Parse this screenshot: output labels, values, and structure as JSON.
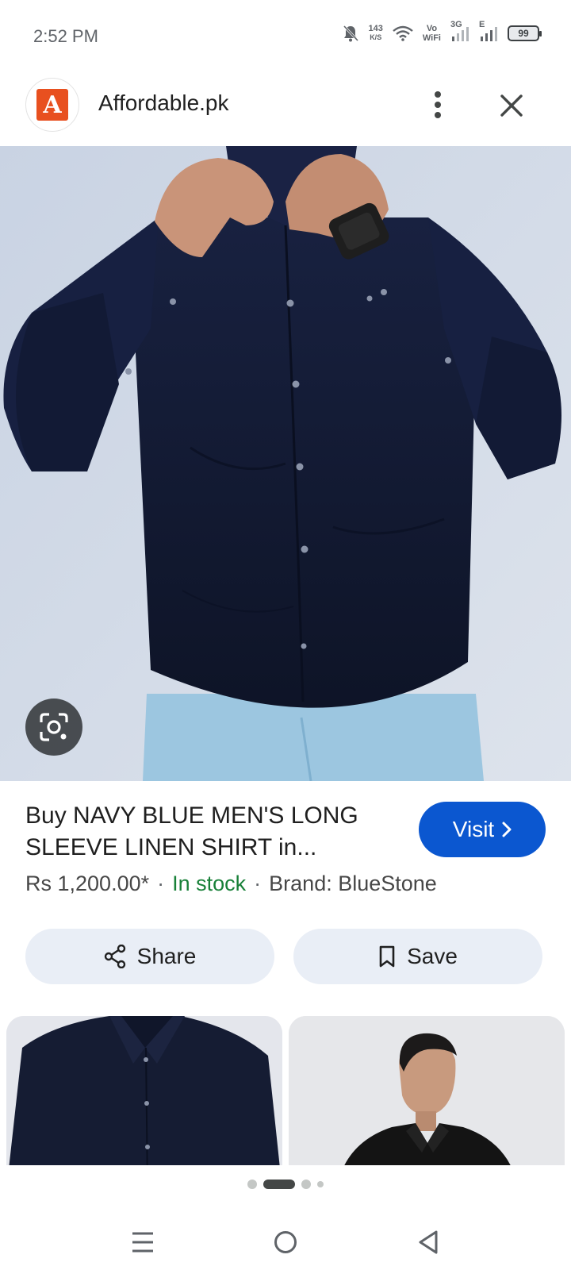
{
  "status_bar": {
    "time": "2:52 PM",
    "net_speed_value": "143",
    "net_speed_unit": "K/S",
    "vowifi_top": "Vo",
    "vowifi_bottom": "WiFi",
    "signal1_label": "3G",
    "signal2_label": "E",
    "battery": "99"
  },
  "header": {
    "logo_letter": "A",
    "site_name": "Affordable.pk"
  },
  "product": {
    "title": "Buy NAVY BLUE MEN'S LONG SLEEVE LINEN SHIRT in...",
    "price": "Rs 1,200.00*",
    "availability": "In stock",
    "brand": "Brand: BlueStone",
    "separator": "·"
  },
  "actions": {
    "visit_label": "Visit",
    "share_label": "Share",
    "save_label": "Save"
  },
  "pager": {
    "count": 4,
    "active_index": 1
  },
  "colors": {
    "accent": "#0b57d0",
    "stock_green": "#188038",
    "chip_bg": "#e9eef6",
    "logo_orange": "#e8501f",
    "shirt_navy": "#141b30"
  },
  "icons": {
    "status": [
      "mute-bell-icon",
      "wifi-icon",
      "signal-icon",
      "battery-icon"
    ],
    "header": [
      "three-dot-menu-icon",
      "close-icon"
    ],
    "image": [
      "lens-search-icon"
    ],
    "buttons": [
      "chevron-right-icon",
      "share-icon",
      "bookmark-icon"
    ],
    "nav": [
      "recents-icon",
      "home-icon",
      "back-icon"
    ]
  }
}
